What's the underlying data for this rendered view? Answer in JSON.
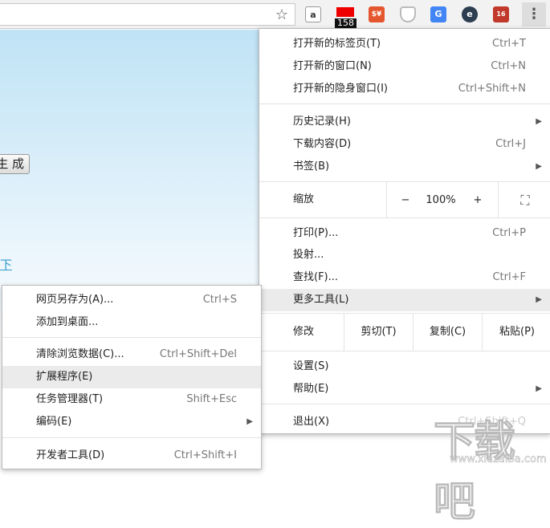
{
  "toolbar": {
    "extensions": [
      {
        "name": "amazon-extension",
        "label": "a",
        "color": "#555"
      },
      {
        "name": "red-extension",
        "badge": "158",
        "color": "#e00"
      },
      {
        "name": "currency-extension",
        "label": "$¥",
        "color": "#e4572e"
      },
      {
        "name": "shield-extension",
        "color": "#aaa"
      },
      {
        "name": "translate-extension",
        "label": "G",
        "color": "#4285f4"
      },
      {
        "name": "e-extension",
        "label": "e",
        "color": "#2c3e50"
      },
      {
        "name": "calendar-extension",
        "label": "16",
        "color": "#c0392b"
      }
    ]
  },
  "page": {
    "button_label": "生 成",
    "link_text": "下"
  },
  "main_menu": {
    "new_tab": {
      "label": "打开新的标签页(T)",
      "shortcut": "Ctrl+T"
    },
    "new_window": {
      "label": "打开新的窗口(N)",
      "shortcut": "Ctrl+N"
    },
    "incognito": {
      "label": "打开新的隐身窗口(I)",
      "shortcut": "Ctrl+Shift+N"
    },
    "history": {
      "label": "历史记录(H)"
    },
    "downloads": {
      "label": "下载内容(D)",
      "shortcut": "Ctrl+J"
    },
    "bookmarks": {
      "label": "书签(B)"
    },
    "zoom": {
      "label": "缩放",
      "minus": "−",
      "value": "100%",
      "plus": "+"
    },
    "print": {
      "label": "打印(P)...",
      "shortcut": "Ctrl+P"
    },
    "cast": {
      "label": "投射..."
    },
    "find": {
      "label": "查找(F)...",
      "shortcut": "Ctrl+F"
    },
    "more_tools": {
      "label": "更多工具(L)"
    },
    "edit": {
      "label": "修改",
      "cut": "剪切(T)",
      "copy": "复制(C)",
      "paste": "粘贴(P)"
    },
    "settings": {
      "label": "设置(S)"
    },
    "help": {
      "label": "帮助(E)"
    },
    "exit": {
      "label": "退出(X)",
      "shortcut": "Ctrl+Shift+Q"
    }
  },
  "sub_menu": {
    "save_as": {
      "label": "网页另存为(A)...",
      "shortcut": "Ctrl+S"
    },
    "add_desktop": {
      "label": "添加到桌面..."
    },
    "clear_data": {
      "label": "清除浏览数据(C)...",
      "shortcut": "Ctrl+Shift+Del"
    },
    "extensions": {
      "label": "扩展程序(E)"
    },
    "task_manager": {
      "label": "任务管理器(T)",
      "shortcut": "Shift+Esc"
    },
    "encoding": {
      "label": "编码(E)"
    },
    "dev_tools": {
      "label": "开发者工具(D)",
      "shortcut": "Ctrl+Shift+I"
    }
  },
  "watermark": {
    "text": "下载吧",
    "url": "www.xiazaiba.com"
  }
}
